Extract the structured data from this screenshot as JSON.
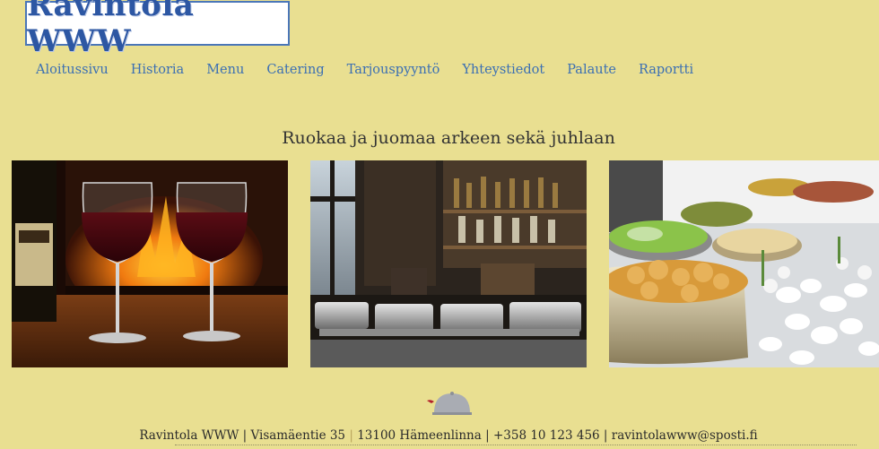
{
  "logo": {
    "text": "Ravintola WWW"
  },
  "nav": {
    "items": [
      {
        "label": "Aloitussivu"
      },
      {
        "label": "Historia"
      },
      {
        "label": "Menu"
      },
      {
        "label": "Catering"
      },
      {
        "label": "Tarjouspyyntö"
      },
      {
        "label": "Yhteystiedot"
      },
      {
        "label": "Palaute"
      },
      {
        "label": "Raportti"
      }
    ]
  },
  "main": {
    "headline": "Ruokaa ja juomaa arkeen sekä juhlaan"
  },
  "footer": {
    "name": "Ravintola WWW",
    "street": "Visamäentie 35",
    "city": "13100 Hämeenlinna",
    "phone": "+358 10 123 456",
    "email": "ravintolawww@sposti.fi"
  },
  "colors": {
    "background": "#e9df91",
    "nav_link": "#3b6fb3",
    "logo_text": "#2d57a3",
    "logo_border": "#4a76b8"
  },
  "icons": {
    "logo_mark": "cloche-icon"
  }
}
